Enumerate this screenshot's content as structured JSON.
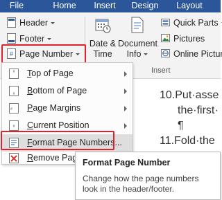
{
  "tabs": [
    "File",
    "Home",
    "Insert",
    "Design",
    "Layout"
  ],
  "header_footer": {
    "header_label": "Header",
    "footer_label": "Footer",
    "page_number_label": "Page Number"
  },
  "insert_group": {
    "date_time_line1": "Date &",
    "date_time_line2": "Time",
    "document_info_line1": "Document",
    "document_info_line2": "Info",
    "quick_parts_label": "Quick Parts",
    "pictures_label": "Pictures",
    "online_pictures_label": "Online Pictur",
    "group_label": "Insert"
  },
  "page_number_menu": {
    "items": [
      {
        "label": "Top of Page",
        "mnemonic": "T",
        "rest": "op of Page",
        "submenu": true
      },
      {
        "label": "Bottom of Page",
        "mnemonic": "B",
        "rest": "ottom of Page",
        "submenu": true
      },
      {
        "label": "Page Margins",
        "mnemonic": "P",
        "rest": "age Margins",
        "submenu": true
      },
      {
        "label": "Current Position",
        "mnemonic": "C",
        "rest": "urrent Position",
        "submenu": true
      },
      {
        "label": "Format Page Numbers...",
        "mnemonic": "F",
        "rest": "ormat Page Numbers...",
        "submenu": false,
        "highlighted": true
      },
      {
        "label": "Remove Pag",
        "mnemonic": "R",
        "rest": "emove Pag",
        "submenu": false
      }
    ]
  },
  "document": {
    "line1": "10.Put·asse",
    "line2": "the·first·",
    "line3": "¶",
    "line4": "11.Fold·the"
  },
  "tooltip": {
    "title": "Format Page Number",
    "description_line1": "Change how the page numbers",
    "description_line2": "look in the header/footer."
  },
  "colors": {
    "ribbon_tab_bg": "#2b579a",
    "highlight_red": "#e0202a",
    "menu_hover": "#dedede"
  }
}
